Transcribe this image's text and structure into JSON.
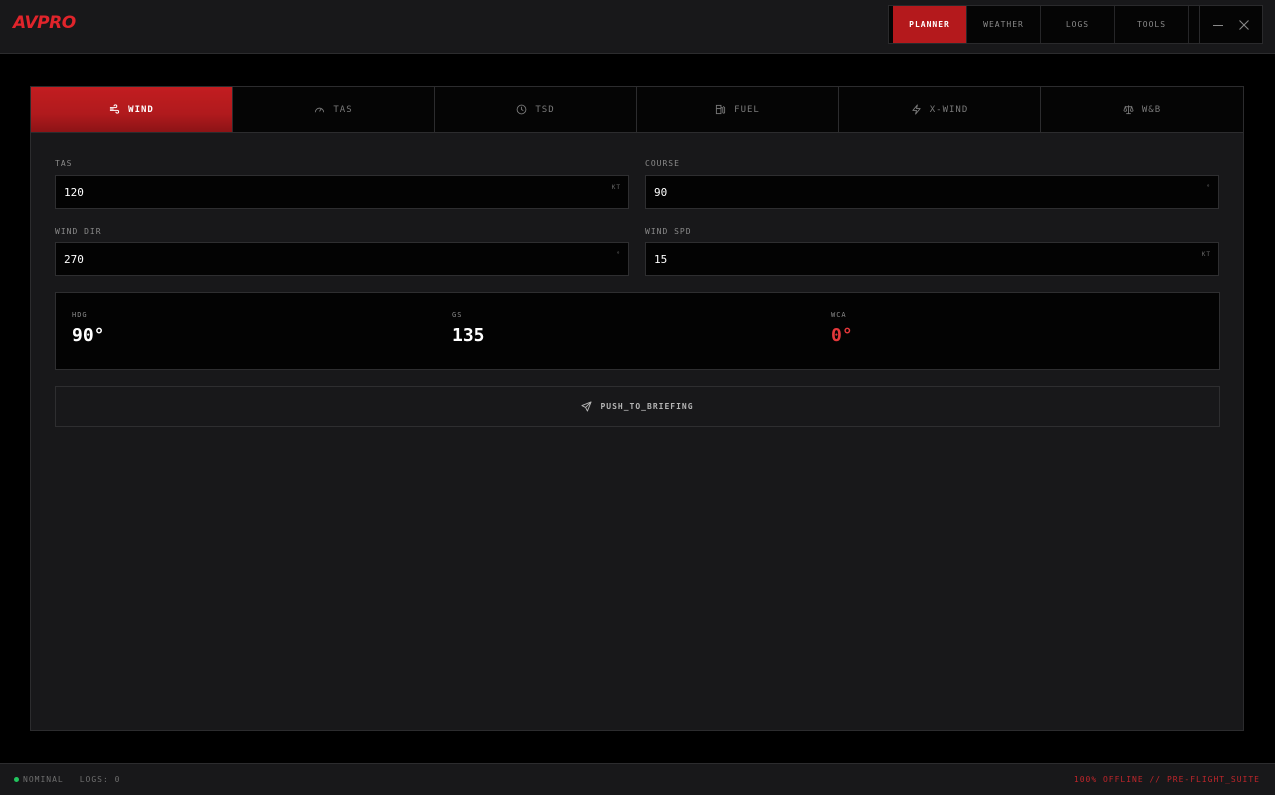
{
  "app": {
    "logo": "AVPRO"
  },
  "nav": {
    "items": [
      {
        "label": "PLANNER"
      },
      {
        "label": "WEATHER"
      },
      {
        "label": "LOGS"
      },
      {
        "label": "TOOLS"
      }
    ],
    "active_index": 0
  },
  "tabs": {
    "items": [
      {
        "label": "WIND",
        "icon": "wind-icon"
      },
      {
        "label": "TAS",
        "icon": "gauge-icon"
      },
      {
        "label": "TSD",
        "icon": "clock-icon"
      },
      {
        "label": "FUEL",
        "icon": "fuel-icon"
      },
      {
        "label": "X-WIND",
        "icon": "lightning-icon"
      },
      {
        "label": "W&B",
        "icon": "scale-icon"
      }
    ],
    "active_index": 0
  },
  "form": {
    "tas": {
      "label": "TAS",
      "value": "120",
      "unit": "KT"
    },
    "course": {
      "label": "COURSE",
      "value": "90",
      "unit": "°"
    },
    "wind_dir": {
      "label": "WIND DIR",
      "value": "270",
      "unit": "°"
    },
    "wind_spd": {
      "label": "WIND SPD",
      "value": "15",
      "unit": "KT"
    }
  },
  "results": {
    "hdg": {
      "label": "HDG",
      "value": "90°"
    },
    "gs": {
      "label": "GS",
      "value": "135"
    },
    "wca": {
      "label": "WCA",
      "value": "0°"
    }
  },
  "push_button": {
    "label": "PUSH_TO_BRIEFING",
    "icon": "send-icon"
  },
  "status": {
    "state": "NOMINAL",
    "logs": "LOGS: 0",
    "right": "100% OFFLINE // PRE-FLIGHT_SUITE"
  },
  "colors": {
    "accent": "#b4191c",
    "danger": "#e5383b",
    "ok": "#22c55e"
  }
}
